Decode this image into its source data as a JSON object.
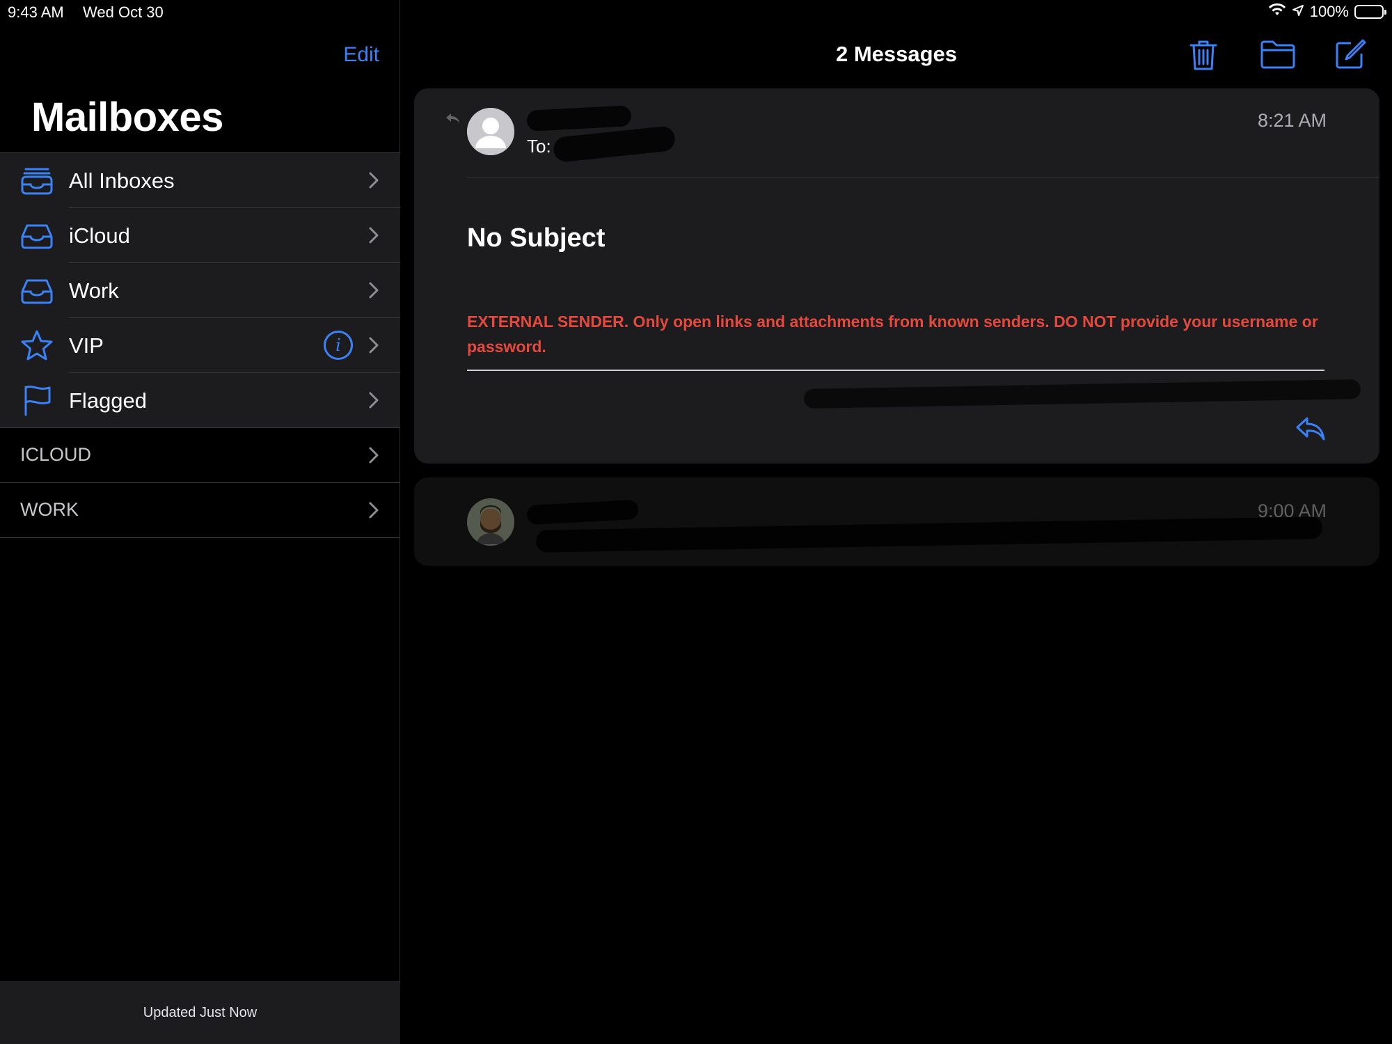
{
  "status_bar": {
    "time": "9:43 AM",
    "date": "Wed Oct 30",
    "battery": "100%"
  },
  "sidebar": {
    "edit_label": "Edit",
    "title": "Mailboxes",
    "mailboxes": [
      {
        "label": "All Inboxes",
        "icon": "tray-stack-icon"
      },
      {
        "label": "iCloud",
        "icon": "tray-icon"
      },
      {
        "label": "Work",
        "icon": "tray-icon"
      },
      {
        "label": "VIP",
        "icon": "star-icon"
      },
      {
        "label": "Flagged",
        "icon": "flag-icon"
      }
    ],
    "sections": [
      {
        "label": "ICLOUD"
      },
      {
        "label": "WORK"
      }
    ],
    "footer": "Updated Just Now"
  },
  "main": {
    "title": "2 Messages",
    "toolbar": [
      "trash-icon",
      "folder-icon",
      "compose-icon"
    ],
    "messages": [
      {
        "to_prefix": "To:",
        "time": "8:21 AM",
        "subject": "No Subject",
        "warning": "EXTERNAL SENDER. Only open links and attachments from known senders. DO NOT provide your username or password."
      },
      {
        "time": "9:00 AM"
      }
    ]
  },
  "colors": {
    "accent": "#3b82f6",
    "warning": "#e5483c",
    "card": "#1c1c1e",
    "background": "#000000"
  }
}
